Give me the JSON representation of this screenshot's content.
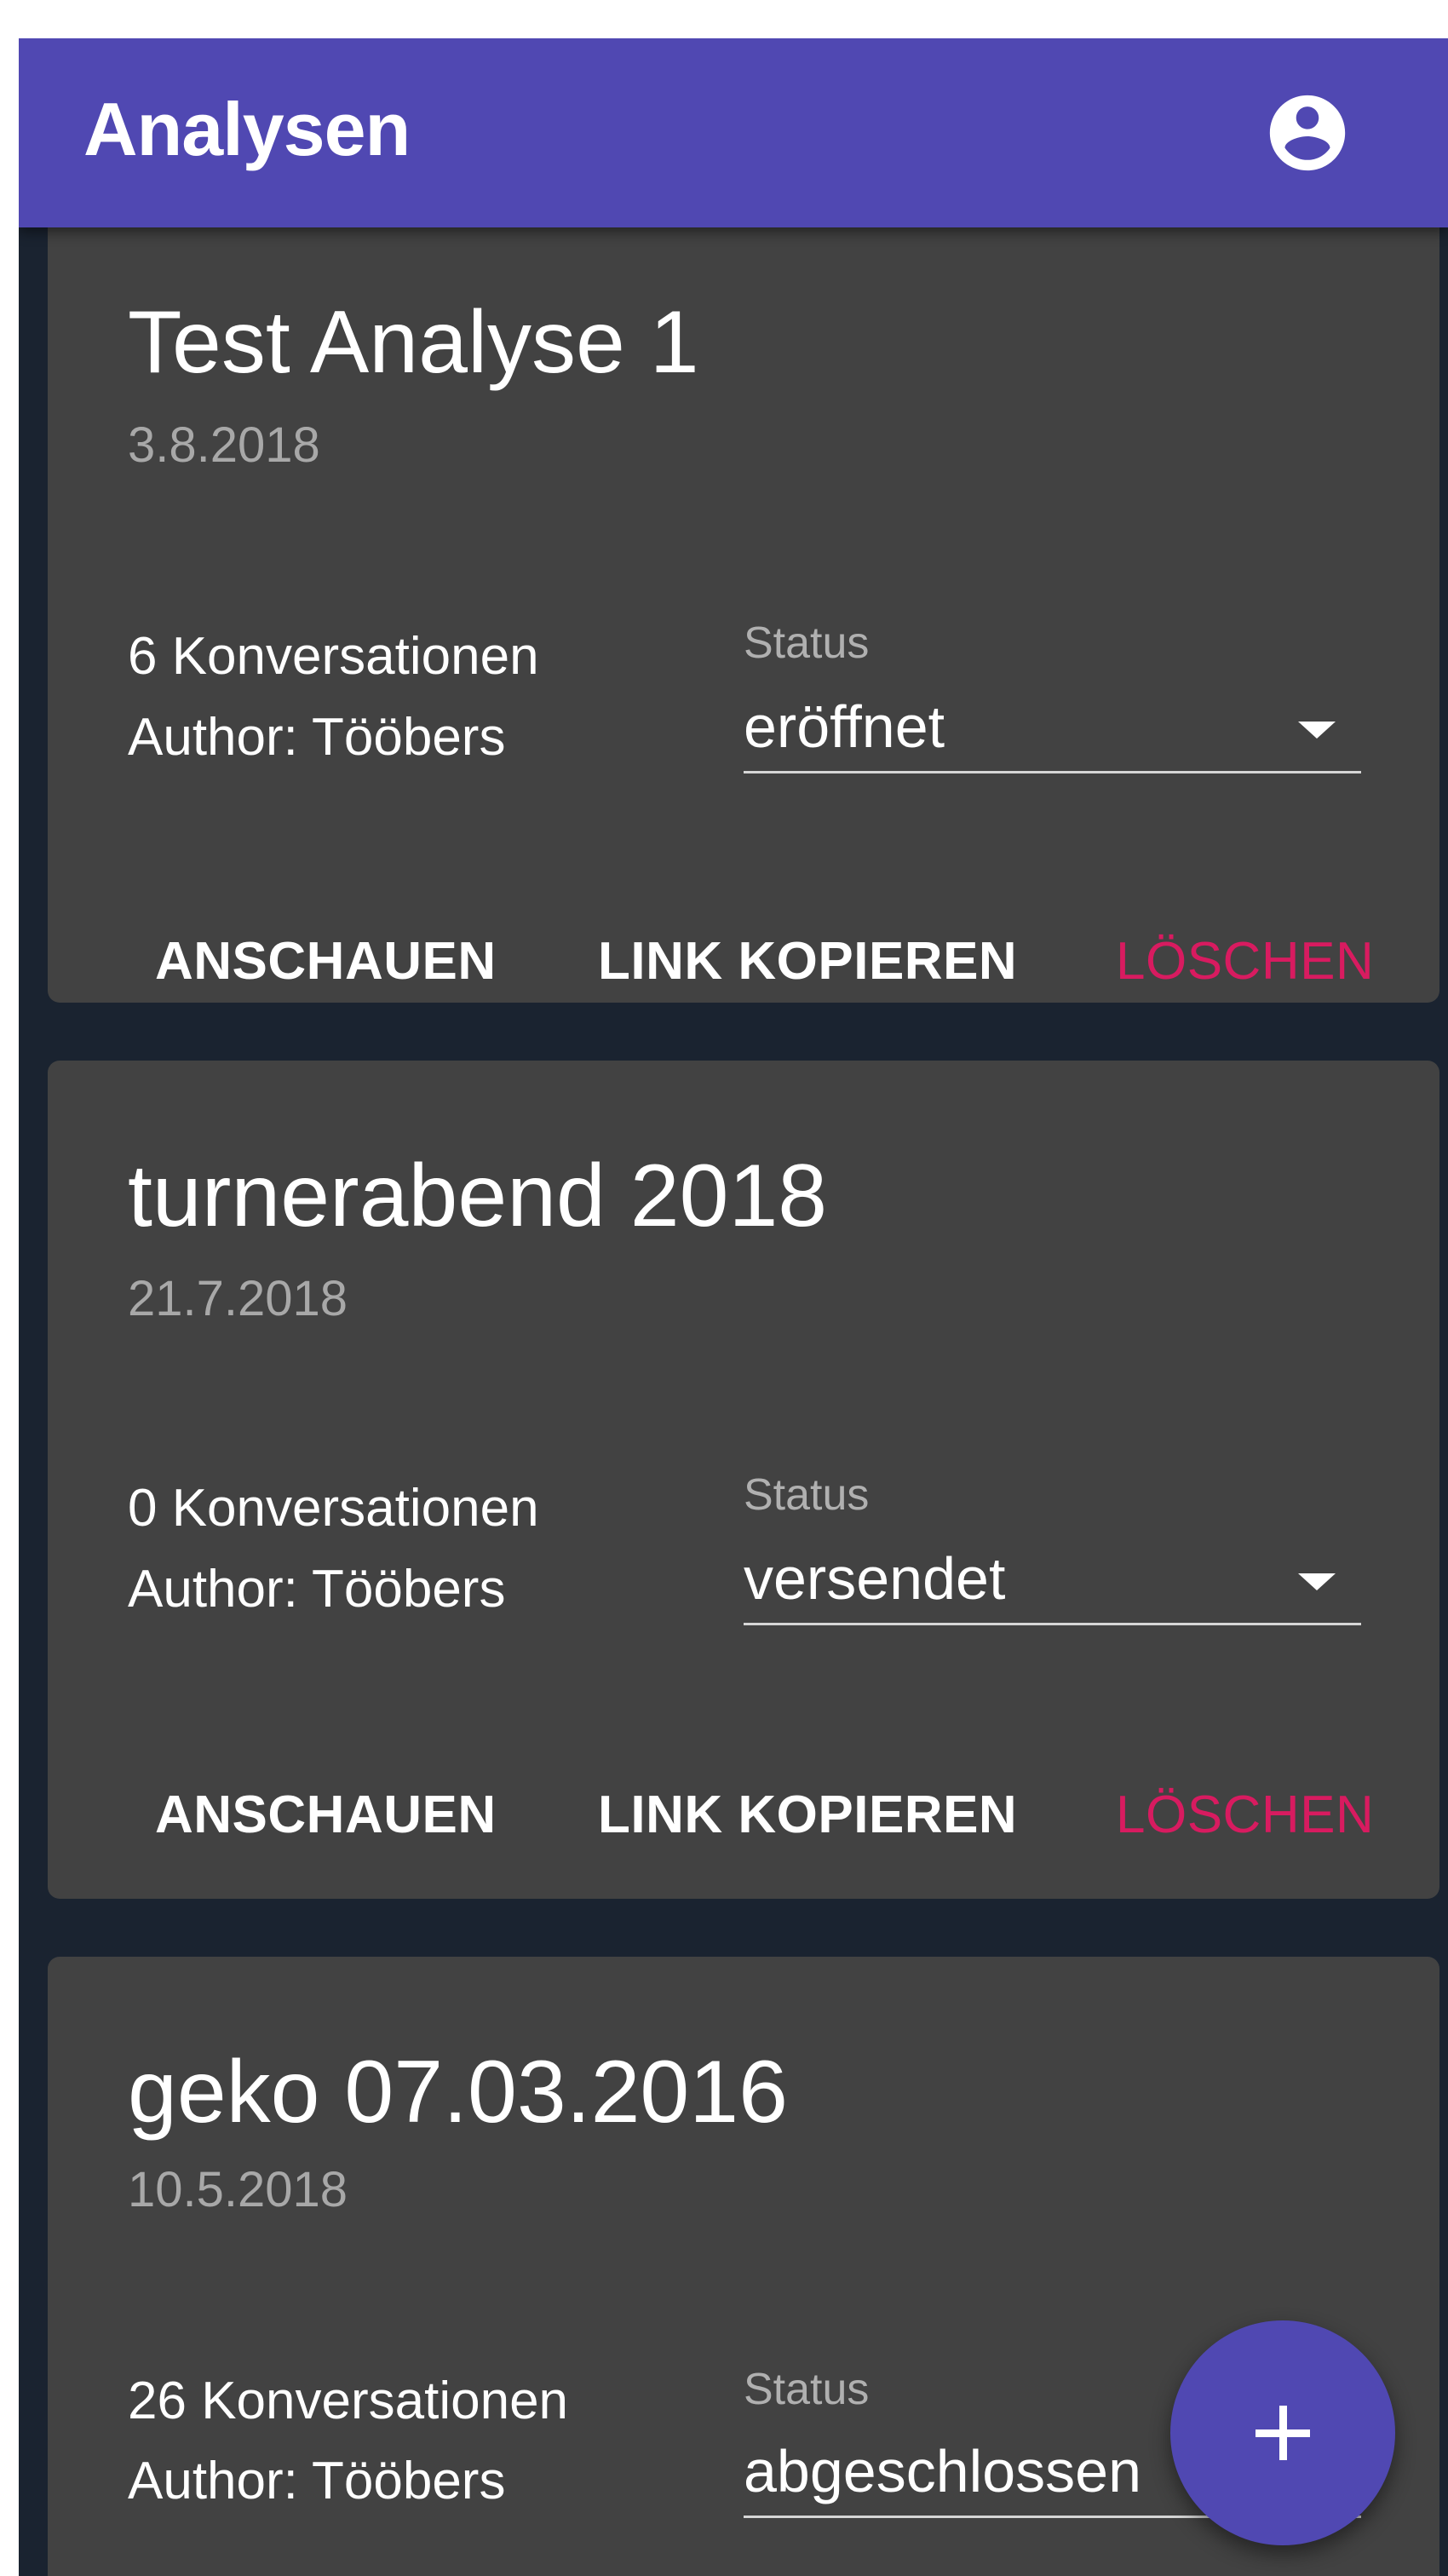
{
  "appbar": {
    "title": "Analysen",
    "account_icon": "account-circle-icon"
  },
  "cards": [
    {
      "title": "Test Analyse 1",
      "date": "3.8.2018",
      "conversations": "6 Konversationen",
      "author": "Author: Tööbers",
      "status_label": "Status",
      "status_value": "eröffnet",
      "actions": {
        "view": "ANSCHAUEN",
        "copy_link": "LINK KOPIEREN",
        "delete": "LÖSCHEN"
      }
    },
    {
      "title": "turnerabend 2018",
      "date": "21.7.2018",
      "conversations": "0 Konversationen",
      "author": "Author: Tööbers",
      "status_label": "Status",
      "status_value": "versendet",
      "actions": {
        "view": "ANSCHAUEN",
        "copy_link": "LINK KOPIEREN",
        "delete": "LÖSCHEN"
      }
    },
    {
      "title": "geko 07.03.2016",
      "date": "10.5.2018",
      "conversations": "26 Konversationen",
      "author": "Author: Tööbers",
      "status_label": "Status",
      "status_value": "abgeschlossen"
    }
  ],
  "fab": {
    "icon": "plus-icon"
  },
  "colors": {
    "primary": "#5048b2",
    "background": "#1a2330",
    "card": "#424242",
    "danger": "#d81b60"
  }
}
